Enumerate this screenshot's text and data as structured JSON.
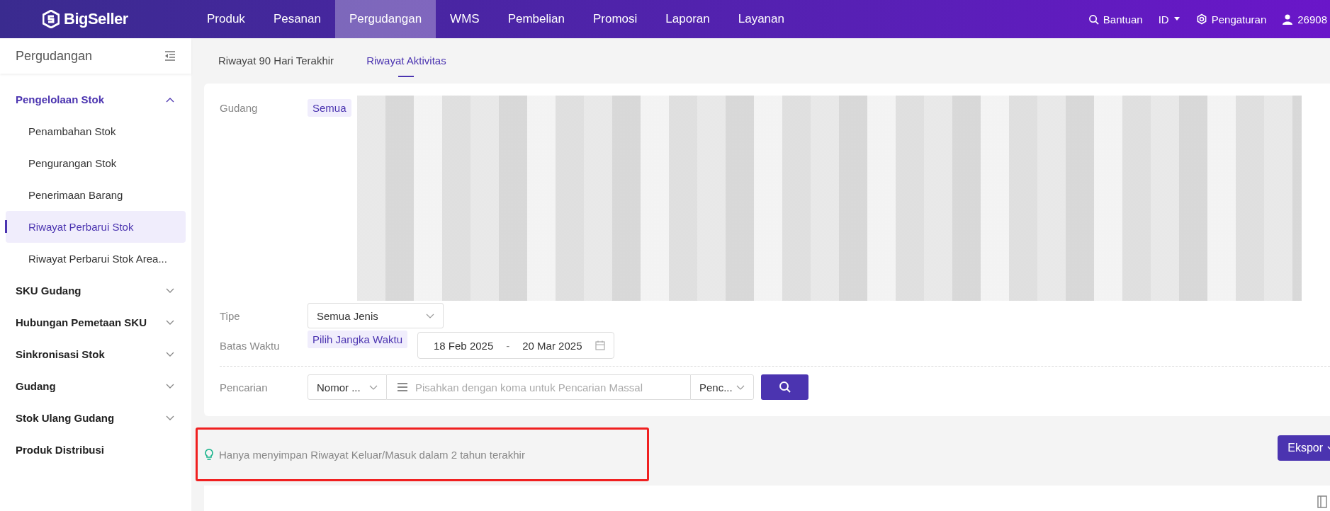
{
  "top_nav": {
    "logo": "BigSeller",
    "items": [
      {
        "label": "Produk",
        "selected": false
      },
      {
        "label": "Pesanan",
        "selected": false
      },
      {
        "label": "Pergudangan",
        "selected": true
      },
      {
        "label": "WMS",
        "selected": false
      },
      {
        "label": "Pembelian",
        "selected": false
      },
      {
        "label": "Promosi",
        "selected": false
      },
      {
        "label": "Laporan",
        "selected": false
      },
      {
        "label": "Layanan",
        "selected": false
      }
    ],
    "help": "Bantuan",
    "language": "ID",
    "settings": "Pengaturan",
    "user": "26908"
  },
  "sidebar": {
    "title": "Pergudangan",
    "groups": [
      {
        "label": "Pengelolaan Stok",
        "selected": true,
        "expanded": true,
        "children": [
          {
            "label": "Penambahan Stok",
            "selected": false
          },
          {
            "label": "Pengurangan Stok",
            "selected": false
          },
          {
            "label": "Penerimaan Barang",
            "selected": false
          },
          {
            "label": "Riwayat Perbarui Stok",
            "selected": true
          },
          {
            "label": "Riwayat Perbarui Stok Area...",
            "selected": false
          }
        ]
      },
      {
        "label": "SKU Gudang",
        "selected": false,
        "expanded": false
      },
      {
        "label": "Hubungan Pemetaan SKU",
        "selected": false,
        "expanded": false
      },
      {
        "label": "Sinkronisasi Stok",
        "selected": false,
        "expanded": false
      },
      {
        "label": "Gudang",
        "selected": false,
        "expanded": false
      },
      {
        "label": "Stok Ulang Gudang",
        "selected": false,
        "expanded": false
      },
      {
        "label": "Produk Distribusi",
        "selected": false
      }
    ]
  },
  "tabs": [
    {
      "label": "Riwayat 90 Hari Terakhir",
      "selected": false
    },
    {
      "label": "Riwayat Aktivitas",
      "selected": true
    }
  ],
  "filters": {
    "warehouse": {
      "label": "Gudang",
      "chip": "Semua"
    },
    "type": {
      "label": "Tipe",
      "value": "Semua Jenis"
    },
    "time": {
      "label": "Batas Waktu",
      "chip": "Pilih Jangka Waktu",
      "start": "18 Feb 2025",
      "separator": "-",
      "end": "20 Mar 2025"
    },
    "search": {
      "label": "Pencarian",
      "field": "Nomor ...",
      "placeholder": "Pisahkan dengan koma untuk Pencarian Massal",
      "mode": "Penc..."
    }
  },
  "tip": "Hanya menyimpan Riwayat Keluar/Masuk dalam 2 tahun terakhir",
  "export_button": "Ekspor"
}
